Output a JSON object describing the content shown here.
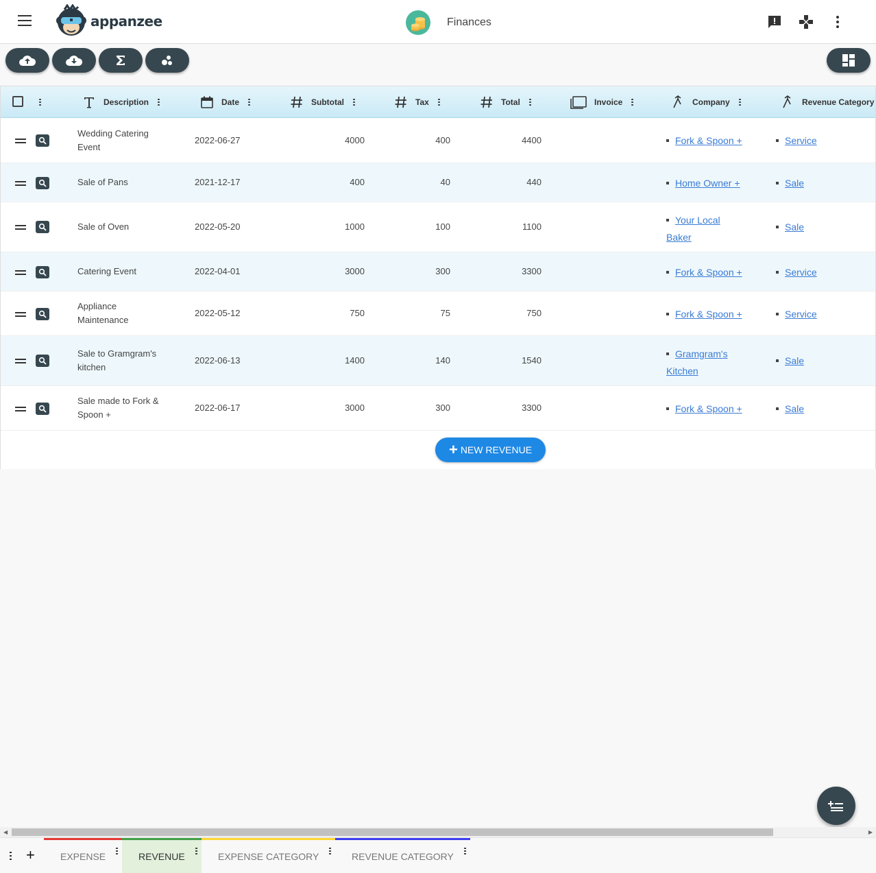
{
  "header": {
    "logo_text": "appanzee",
    "app_title": "Finances",
    "icons": [
      "menu-icon",
      "feedback-icon",
      "game-controller-icon",
      "more-vert-icon"
    ]
  },
  "toolbar": {
    "buttons": [
      "upload-cloud-icon",
      "download-cloud-icon",
      "sigma-icon",
      "bubbles-icon",
      "dashboard-layout-icon"
    ]
  },
  "table": {
    "columns": [
      {
        "label": "Description",
        "icon": "text-icon"
      },
      {
        "label": "Date",
        "icon": "calendar-icon"
      },
      {
        "label": "Subtotal",
        "icon": "hash-icon"
      },
      {
        "label": "Tax",
        "icon": "hash-icon"
      },
      {
        "label": "Total",
        "icon": "hash-icon"
      },
      {
        "label": "Invoice",
        "icon": "file-icon"
      },
      {
        "label": "Company",
        "icon": "relation-icon"
      },
      {
        "label": "Revenue Category",
        "icon": "relation-icon"
      }
    ],
    "rows": [
      {
        "description": "Wedding Catering Event",
        "date": "2022-06-27",
        "subtotal": "4000",
        "tax": "400",
        "total": "4400",
        "invoice": "",
        "company": "Fork & Spoon +",
        "category": "Service"
      },
      {
        "description": "Sale of Pans",
        "date": "2021-12-17",
        "subtotal": "400",
        "tax": "40",
        "total": "440",
        "invoice": "",
        "company": "Home Owner +",
        "category": "Sale"
      },
      {
        "description": "Sale of Oven",
        "date": "2022-05-20",
        "subtotal": "1000",
        "tax": "100",
        "total": "1100",
        "invoice": "",
        "company": "Your Local Baker",
        "category": "Sale"
      },
      {
        "description": "Catering Event",
        "date": "2022-04-01",
        "subtotal": "3000",
        "tax": "300",
        "total": "3300",
        "invoice": "",
        "company": "Fork & Spoon +",
        "category": "Service"
      },
      {
        "description": "Appliance Maintenance",
        "date": "2022-05-12",
        "subtotal": "750",
        "tax": "75",
        "total": "750",
        "invoice": "",
        "company": "Fork & Spoon +",
        "category": "Service"
      },
      {
        "description": "Sale to Gramgram's kitchen",
        "date": "2022-06-13",
        "subtotal": "1400",
        "tax": "140",
        "total": "1540",
        "invoice": "",
        "company": "Gramgram's Kitchen",
        "category": "Sale"
      },
      {
        "description": "Sale made to Fork & Spoon +",
        "date": "2022-06-17",
        "subtotal": "3000",
        "tax": "300",
        "total": "3300",
        "invoice": "",
        "company": "Fork & Spoon +",
        "category": "Sale"
      }
    ],
    "new_button_label": "NEW REVENUE"
  },
  "tabs": [
    {
      "label": "EXPENSE",
      "color": "#e53935",
      "active": false
    },
    {
      "label": "REVENUE",
      "color": "#43a047",
      "active": true
    },
    {
      "label": "EXPENSE CATEGORY",
      "color": "#fdd835",
      "active": false
    },
    {
      "label": "REVENUE CATEGORY",
      "color": "#3d3df0",
      "active": false
    }
  ],
  "colors": {
    "accent": "#1e88e5",
    "dark_button": "#37474f",
    "header_row": "#c9eaf6",
    "active_tab": "#e2f0dc"
  }
}
